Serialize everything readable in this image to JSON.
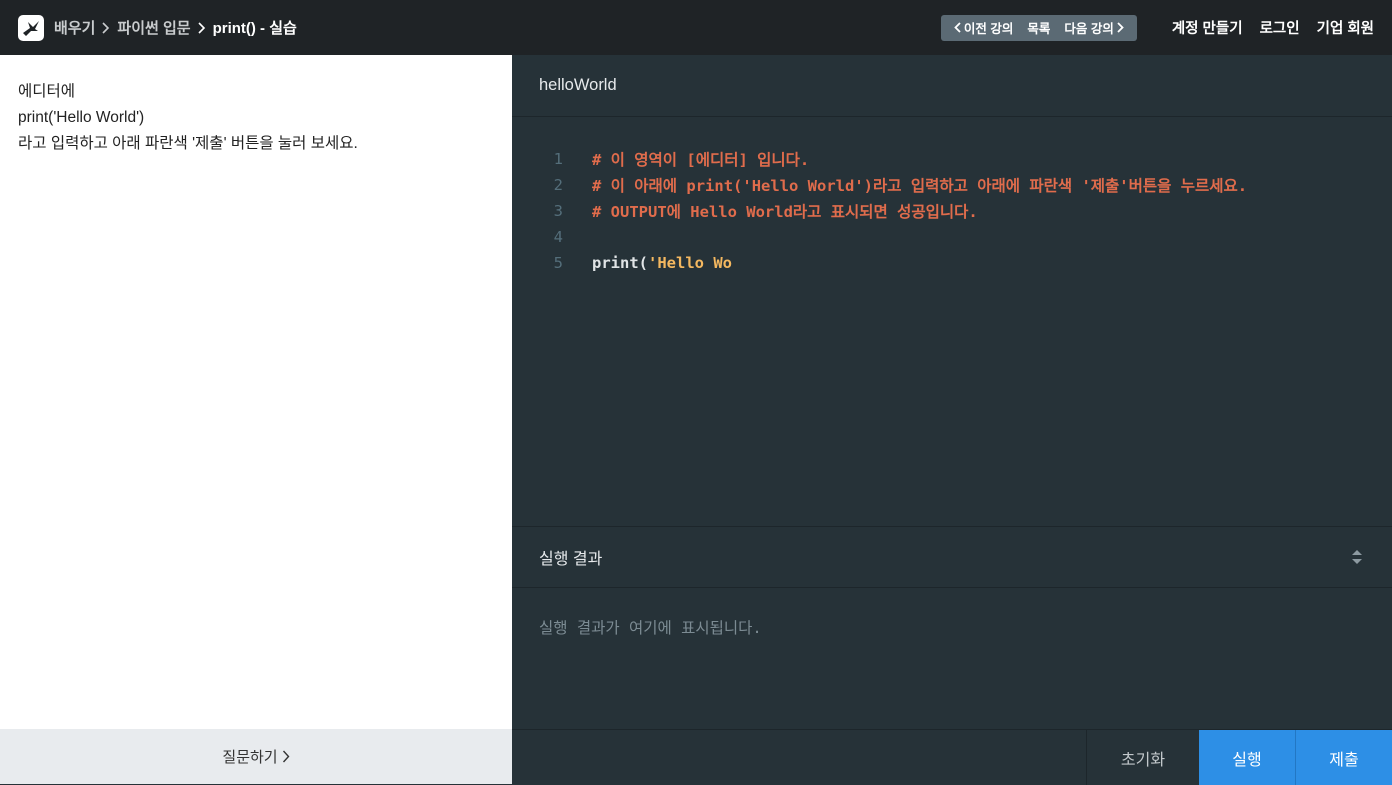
{
  "breadcrumb": {
    "items": [
      "배우기",
      "파이썬 입문",
      "print() - 실습"
    ]
  },
  "lecture_nav": {
    "prev": "이전 강의",
    "list": "목록",
    "next": "다음 강의"
  },
  "header_links": {
    "signup": "계정 만들기",
    "login": "로그인",
    "enterprise": "기업 회원"
  },
  "instructions": {
    "line1": "에디터에",
    "line2": "print('Hello World')",
    "line3": "라고 입력하고 아래 파란색 '제출' 버튼을 눌러 보세요."
  },
  "ask_button": "질문하기",
  "editor": {
    "filename": "helloWorld",
    "lines": [
      {
        "num": "1",
        "text": "# 이 영역이 [에디터] 입니다."
      },
      {
        "num": "2",
        "text": "# 이 아래에 print('Hello World')라고 입력하고 아래에 파란색 '제출'버튼을 누르세요."
      },
      {
        "num": "3",
        "text": "# OUTPUT에 Hello World라고 표시되면 성공입니다."
      },
      {
        "num": "4",
        "text": ""
      },
      {
        "num": "5",
        "code": "print(",
        "string": "'Hello Wo"
      }
    ]
  },
  "output": {
    "title": "실행 결과",
    "placeholder": "실행 결과가 여기에 표시됩니다."
  },
  "buttons": {
    "reset": "초기화",
    "run": "실행",
    "submit": "제출"
  },
  "colors": {
    "topbar": "#1f2326",
    "editor_bg": "#263238",
    "accent_blue": "#2d8fe6",
    "comment": "#e06c4c",
    "string": "#f4b860"
  }
}
